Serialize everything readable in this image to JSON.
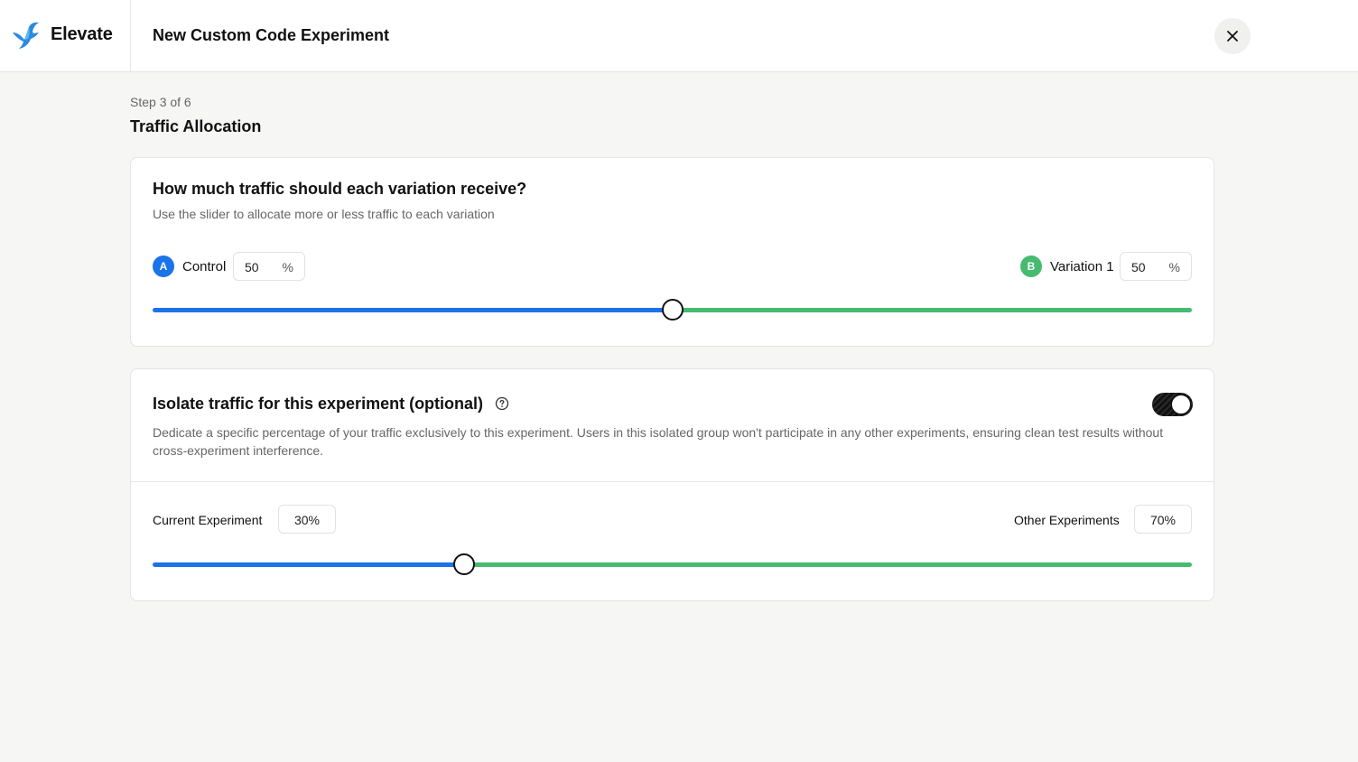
{
  "app": {
    "name": "Elevate"
  },
  "header": {
    "title": "New Custom Code Experiment",
    "close_icon": "close-icon"
  },
  "step": {
    "label": "Step 3 of 6",
    "title": "Traffic Allocation"
  },
  "allocation": {
    "heading": "How much traffic should each variation receive?",
    "subtext": "Use the slider to allocate more or less traffic to each variation",
    "control": {
      "badge": "A",
      "label": "Control",
      "value": "50",
      "unit": "%",
      "color": "#1a73e8"
    },
    "variation": {
      "badge": "B",
      "label": "Variation 1",
      "value": "50",
      "unit": "%",
      "color": "#46bb6f"
    },
    "slider_split_percent": 50
  },
  "isolation": {
    "heading": "Isolate traffic for this experiment (optional)",
    "help_icon": "help-circle-icon",
    "toggle_on": true,
    "description": "Dedicate a specific percentage of your traffic exclusively to this experiment. Users in this isolated group won't participate in any other experiments, ensuring clean test results without cross-experiment interference.",
    "current": {
      "label": "Current Experiment",
      "value": "30%"
    },
    "other": {
      "label": "Other Experiments",
      "value": "70%"
    },
    "slider_split_percent": 30
  },
  "colors": {
    "primary": "#1a73e8",
    "secondary": "#46bb6f"
  }
}
